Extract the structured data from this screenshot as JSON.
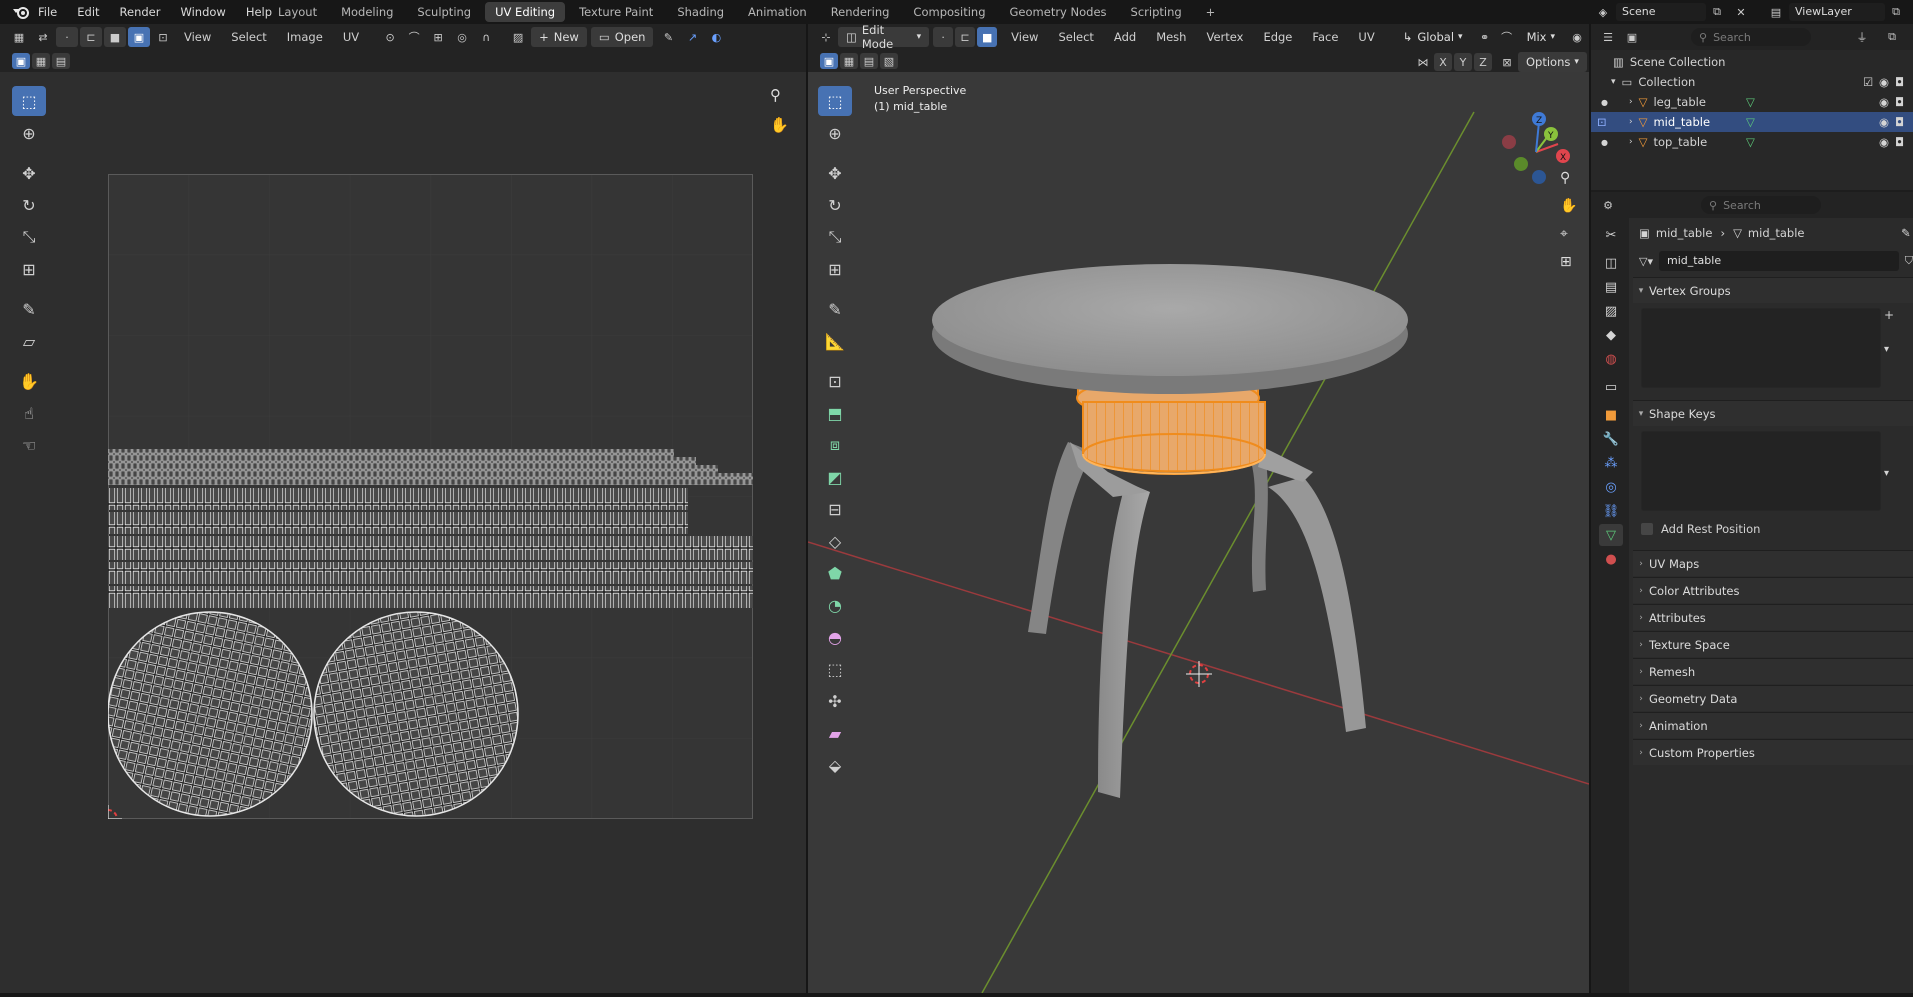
{
  "app": {
    "menu": [
      "File",
      "Edit",
      "Render",
      "Window",
      "Help"
    ],
    "workspace_tabs": [
      "Layout",
      "Modeling",
      "Sculpting",
      "UV Editing",
      "Texture Paint",
      "Shading",
      "Animation",
      "Rendering",
      "Compositing",
      "Geometry Nodes",
      "Scripting"
    ],
    "active_workspace": "UV Editing",
    "add_tab_icon": "plus-icon",
    "scene_name": "Scene",
    "view_layer": "ViewLayer"
  },
  "uv_editor": {
    "menus": [
      "View",
      "Select",
      "Image",
      "UV"
    ],
    "new_label": "New",
    "open_label": "Open",
    "tools": [
      "select-box-icon",
      "cursor-icon",
      "move-icon",
      "rotate-icon",
      "scale-icon",
      "transform-icon",
      "annotate-icon",
      "rip-icon",
      "grab-icon",
      "relax-icon",
      "pinch-icon"
    ]
  },
  "viewport": {
    "mode": "Edit Mode",
    "menus": [
      "View",
      "Select",
      "Add",
      "Mesh",
      "Vertex",
      "Edge",
      "Face",
      "UV"
    ],
    "orientation": "Global",
    "shading_mix": "Mix",
    "axes_toggles": [
      "X",
      "Y",
      "Z"
    ],
    "options_label": "Options",
    "overlay_title": "User Perspective",
    "overlay_object": "(1) mid_table",
    "gizmo_axes": [
      "X",
      "Y",
      "Z"
    ]
  },
  "outliner": {
    "search_placeholder": "Search",
    "scene_collection": "Scene Collection",
    "collection": "Collection",
    "objects": [
      {
        "name": "leg_table",
        "selected": false
      },
      {
        "name": "mid_table",
        "selected": true
      },
      {
        "name": "top_table",
        "selected": false
      }
    ]
  },
  "properties": {
    "search_placeholder": "Search",
    "breadcrumb_object": "mid_table",
    "breadcrumb_data": "mid_table",
    "mesh_name": "mid_table",
    "vertex_groups": "Vertex Groups",
    "shape_keys": "Shape Keys",
    "add_rest_position": "Add Rest Position",
    "panels": [
      "UV Maps",
      "Color Attributes",
      "Attributes",
      "Texture Space",
      "Remesh",
      "Geometry Data",
      "Animation",
      "Custom Properties"
    ]
  },
  "colors": {
    "accent": "#4772b3",
    "selection_orange": "#f08c1c",
    "x_axis": "#e0454d",
    "y_axis": "#8ac23c",
    "z_axis": "#3f7ad6"
  }
}
